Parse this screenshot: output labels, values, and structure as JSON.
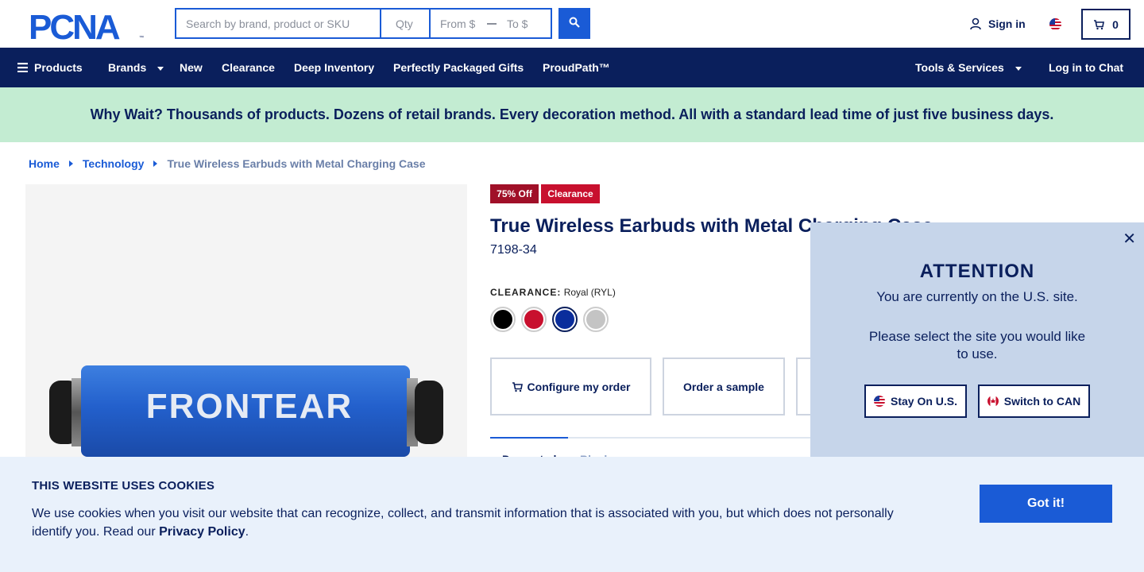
{
  "header": {
    "logo_text": "PCNA",
    "search_placeholder": "Search by brand, product or SKU",
    "qty_placeholder": "Qty",
    "from_placeholder": "From $",
    "to_placeholder": "To $",
    "signin_label": "Sign in",
    "cart_count": "0"
  },
  "nav": {
    "products": "Products",
    "brands": "Brands",
    "new": "New",
    "clearance": "Clearance",
    "deep_inventory": "Deep Inventory",
    "gifts": "Perfectly Packaged Gifts",
    "proudpath": "ProudPath™",
    "tools": "Tools & Services",
    "chat": "Log in to Chat"
  },
  "banner": {
    "text": "Why Wait? Thousands of products. Dozens of retail brands. Every decoration method. All with a standard lead time of just five business days."
  },
  "breadcrumb": {
    "home": "Home",
    "category": "Technology",
    "current": "True Wireless Earbuds with Metal Charging Case"
  },
  "product": {
    "badge_off": "75% Off",
    "badge_clearance": "Clearance",
    "title": "True Wireless Earbuds with Metal Charging Case",
    "sku": "7198-34",
    "clearance_label": "CLEARANCE:",
    "clearance_value": "Royal (RYL)",
    "image_brand_text": "FRONTEAR",
    "swatches": [
      {
        "name": "Black",
        "color": "#000000"
      },
      {
        "name": "Red",
        "color": "#c8102e"
      },
      {
        "name": "Royal",
        "color": "#0a2d9c",
        "selected": true
      },
      {
        "name": "Silver",
        "color": "#c4c4c4"
      }
    ],
    "configure_label": "Configure my order",
    "sample_label": "Order a sample",
    "tab_active": "Decorated",
    "tab_inactive": "Blank"
  },
  "popup": {
    "title": "ATTENTION",
    "line1": "You are currently on the U.S. site.",
    "line2": "Please select the site you would like to use.",
    "stay_label": "Stay On U.S.",
    "switch_label": "Switch to CAN"
  },
  "cookies": {
    "title": "THIS WEBSITE USES COOKIES",
    "text": "We use cookies when you visit our website that can recognize, collect, and transmit information that is associated with you, but which does not personally identify you. Read our ",
    "link": "Privacy Policy",
    "period": ".",
    "button": "Got it!"
  },
  "colors": {
    "navy": "#0a1f5c",
    "accent_blue": "#1a5bd6",
    "banner_green": "#c3ecd2",
    "badge_red": "#c8102e"
  }
}
